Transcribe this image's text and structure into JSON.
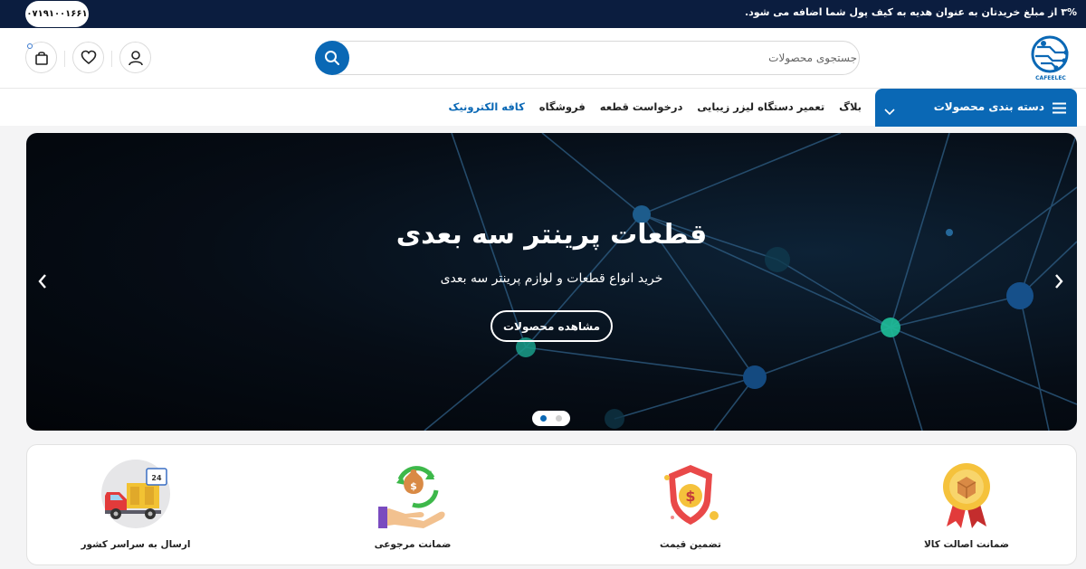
{
  "topbar": {
    "promo": "۳% از مبلغ خریدتان به عنوان هدیه به کیف پول شما اضافه می شود.",
    "phone": "۰۷۱۹۱۰۰۱۶۶۱"
  },
  "header": {
    "logo_text": "CAFEELEC",
    "search_placeholder": "جستجوی محصولات"
  },
  "nav": {
    "categories_label": "دسته بندی محصولات",
    "links": [
      "کافه الکترونیک",
      "فروشگاه",
      "درخواست قطعه",
      "تعمیر دستگاه لیزر زیبایی",
      "بلاگ"
    ],
    "active_index": 0
  },
  "hero": {
    "title": "قطعات پرینتر سه بعدی",
    "subtitle": "خرید انواع قطعات و لوازم پرینتر سه بعدی",
    "cta": "مشاهده محصولات",
    "slide_count": 2,
    "active_slide": 0
  },
  "features": [
    {
      "label": "ضمانت اصالت کالا",
      "icon": "award-badge-icon"
    },
    {
      "label": "تضمین قیمت",
      "icon": "price-shield-icon"
    },
    {
      "label": "ضمانت مرجوعی",
      "icon": "money-return-icon"
    },
    {
      "label": "ارسال به سراسر کشور",
      "icon": "delivery-truck-icon"
    }
  ],
  "colors": {
    "primary": "#0a68b5",
    "topbar": "#0b1d3f",
    "accent_teal": "#1fbf9a"
  }
}
